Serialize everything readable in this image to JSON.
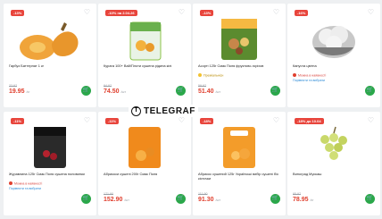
{
  "watermark": {
    "text": "TELEGRAF",
    "logo_letter": "T"
  },
  "products": [
    {
      "badge": "-13%",
      "name": "Гарбуз Баттернат 1 кг",
      "tag": "",
      "tag_kind": "",
      "old_price": "22.97",
      "price": "19.95",
      "unit": "/кг"
    },
    {
      "badge": "-10% на 2.04.26",
      "name": "Курага 100+ Вай/Плоти сушена рідина кілі",
      "tag": "",
      "tag_kind": "",
      "old_price": "84.97",
      "price": "74.50",
      "unit": "/шт"
    },
    {
      "badge": "-13%",
      "name": "Асорті 125г Смак Поля фруктово-горіхов",
      "tag": "Преміальнісн",
      "tag_kind": "gold",
      "old_price": "59.97",
      "price": "51.40",
      "unit": "/шт"
    },
    {
      "badge": "-16%",
      "name": "Капуста цвітна",
      "tag": "Можна в наявності",
      "tag_kind": "warn",
      "tag2": "Порівняти та вибрати",
      "old_price": "",
      "price": "",
      "unit": ""
    },
    {
      "badge": "-11%",
      "name": "Журавлина 125г Смак Поля сушена половинки",
      "tag": "Можна в наявності",
      "tag_kind": "warn",
      "tag2": "Порівняти та вибрати",
      "old_price": "",
      "price": "",
      "unit": ""
    },
    {
      "badge": "-11%",
      "name": "Абрикоси сушені 200г Смак Поля",
      "tag": "",
      "tag_kind": "",
      "old_price": "171.90",
      "price": "152.90",
      "unit": "/шт"
    },
    {
      "badge": "-18%",
      "name": "Абрикос сушений 125г Українські вибір сушені б/к кісточки",
      "tag": "",
      "tag_kind": "",
      "old_price": "111.90",
      "price": "91.30",
      "unit": "/шт"
    },
    {
      "badge": "-18% до 10.04",
      "name": "Виноград Мускаш",
      "tag": "",
      "tag_kind": "",
      "old_price": "95.97",
      "price": "78.95",
      "unit": "/кг"
    }
  ],
  "icons": {
    "favorite": "heart-icon",
    "cart": "cart-icon"
  },
  "colors": {
    "badge": "#e8453c",
    "price": "#e0402f",
    "cart": "#2aa84a"
  }
}
